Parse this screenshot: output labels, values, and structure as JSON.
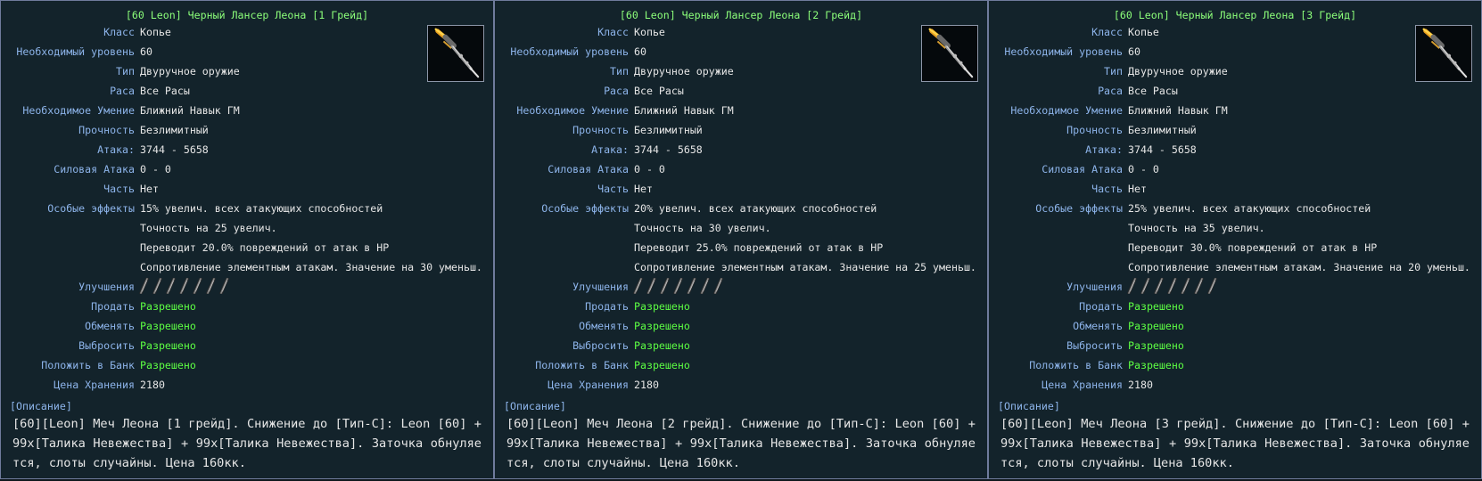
{
  "labels": {
    "class": "Класс",
    "level": "Необходимый уровень",
    "type": "Тип",
    "race": "Раса",
    "skill": "Необходимое Умение",
    "durability": "Прочность",
    "attack": "Атака:",
    "force_attack": "Силовая Атака",
    "part": "Часть",
    "effects": "Особые эффекты",
    "upgrades": "Улучшения",
    "sell": "Продать",
    "trade": "Обменять",
    "drop": "Выбросить",
    "bank": "Положить в Банк",
    "storage": "Цена Хранения",
    "description": "[Описание]"
  },
  "panels": [
    {
      "title": "[60 Leon] Черный Лансер Леона [1 Грейд]",
      "class": "Копье",
      "level": "60",
      "type": "Двуручное оружие",
      "race": "Все Расы",
      "skill": "Ближний Навык ГМ",
      "durability": "Безлимитный",
      "attack": "3744 - 5658",
      "force_attack": "0 - 0",
      "part": "Нет",
      "effects": [
        "15% увелич. всех атакующих способностей",
        "Точность на 25 увелич.",
        "Переводит 20.0% повреждений от атак в HP",
        "Сопротивление элементным атакам. Значение на 30 уменьш."
      ],
      "sell": "Разрешено",
      "trade": "Разрешено",
      "drop": "Разрешено",
      "bank": "Разрешено",
      "storage": "2180",
      "description": "[60][Leon] Меч Леона [1 грейд]. Снижение до [Тип-С]: Leon [60] + 99x[Талика Невежества] + 99x[Талика Невежества]. Заточка обнуляется, слоты случайны. Цена 160кк."
    },
    {
      "title": "[60 Leon] Черный Лансер Леона [2 Грейд]",
      "class": "Копье",
      "level": "60",
      "type": "Двуручное оружие",
      "race": "Все Расы",
      "skill": "Ближний Навык ГМ",
      "durability": "Безлимитный",
      "attack": "3744 - 5658",
      "force_attack": "0 - 0",
      "part": "Нет",
      "effects": [
        "20% увелич. всех атакующих способностей",
        "Точность на 30 увелич.",
        "Переводит 25.0% повреждений от атак в HP",
        "Сопротивление элементным атакам. Значение на 25 уменьш."
      ],
      "sell": "Разрешено",
      "trade": "Разрешено",
      "drop": "Разрешено",
      "bank": "Разрешено",
      "storage": "2180",
      "description": "[60][Leon] Меч Леона [2 грейд]. Снижение до [Тип-С]: Leon [60] + 99x[Талика Невежества] + 99x[Талика Невежества]. Заточка обнуляется, слоты случайны. Цена 160кк."
    },
    {
      "title": "[60 Leon] Черный Лансер Леона [3 Грейд]",
      "class": "Копье",
      "level": "60",
      "type": "Двуручное оружие",
      "race": "Все Расы",
      "skill": "Ближний Навык ГМ",
      "durability": "Безлимитный",
      "attack": "3744 - 5658",
      "force_attack": "0 - 0",
      "part": "Нет",
      "effects": [
        "25% увелич. всех атакующих способностей",
        "Точность на 35 увелич.",
        "Переводит 30.0% повреждений от атак в HP",
        "Сопротивление элементным атакам. Значение на 20 уменьш."
      ],
      "sell": "Разрешено",
      "trade": "Разрешено",
      "drop": "Разрешено",
      "bank": "Разрешено",
      "storage": "2180",
      "description": "[60][Leon] Меч Леона [3 грейд]. Снижение до [Тип-С]: Leon [60] + 99x[Талика Невежества] + 99x[Талика Невежества]. Заточка обнуляется, слоты случайны. Цена 160кк."
    }
  ],
  "icons": {
    "item": "spear-icon",
    "upgrade_slot": "empty-talic-slot-icon"
  },
  "colors": {
    "title": "#8cff7a",
    "label": "#8db4ea",
    "value": "#e6e6e6",
    "allowed": "#5dff43",
    "border": "#6f7b9c"
  }
}
